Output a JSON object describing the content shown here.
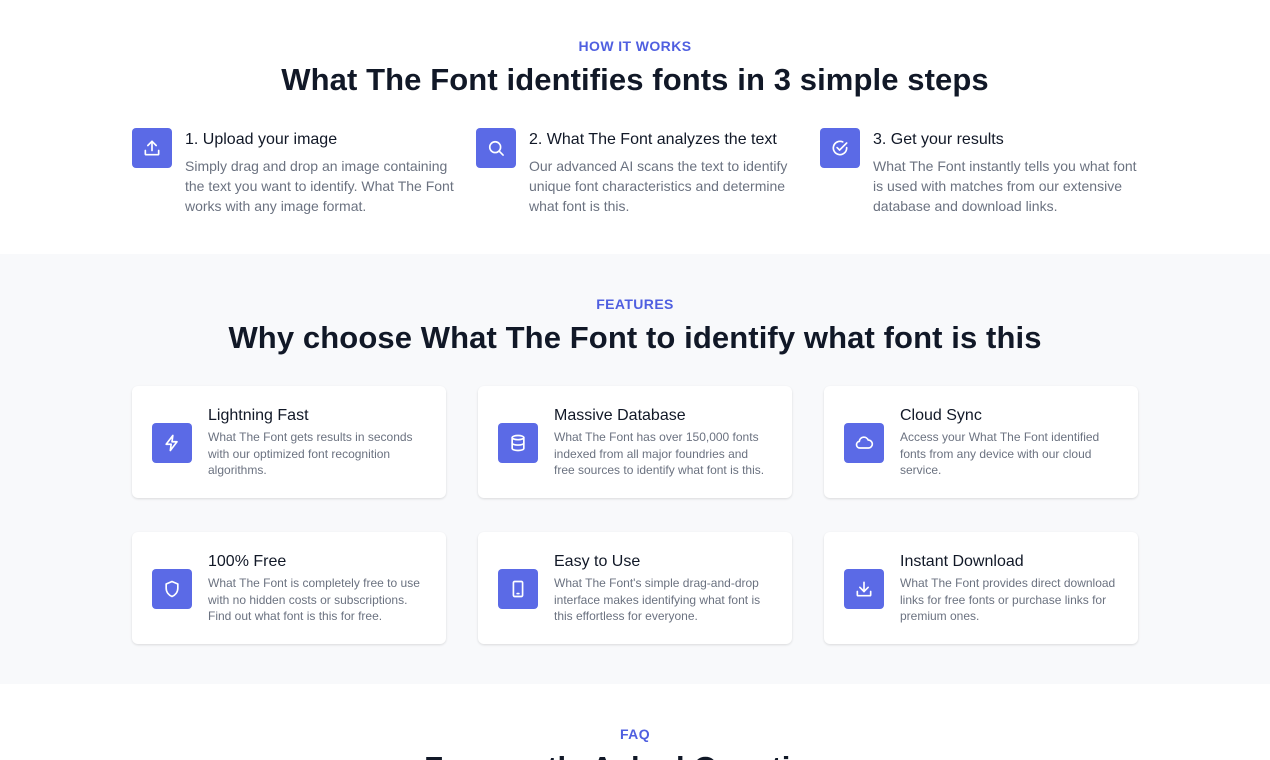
{
  "how_it_works": {
    "eyebrow": "HOW IT WORKS",
    "heading": "What The Font identifies fonts in 3 simple steps",
    "steps": [
      {
        "icon": "upload-icon",
        "title": "1. Upload your image",
        "description": "Simply drag and drop an image containing the text you want to identify. What The Font works with any image format."
      },
      {
        "icon": "search-icon",
        "title": "2. What The Font analyzes the text",
        "description": "Our advanced AI scans the text to identify unique font characteristics and determine what font is this."
      },
      {
        "icon": "check-circle-icon",
        "title": "3. Get your results",
        "description": "What The Font instantly tells you what font is used with matches from our extensive database and download links."
      }
    ]
  },
  "features": {
    "eyebrow": "FEATURES",
    "heading": "Why choose What The Font to identify what font is this",
    "cards": [
      {
        "icon": "lightning-icon",
        "title": "Lightning Fast",
        "description": "What The Font gets results in seconds with our optimized font recognition algorithms."
      },
      {
        "icon": "database-icon",
        "title": "Massive Database",
        "description": "What The Font has over 150,000 fonts indexed from all major foundries and free sources to identify what font is this."
      },
      {
        "icon": "cloud-icon",
        "title": "Cloud Sync",
        "description": "Access your What The Font identified fonts from any device with our cloud service."
      },
      {
        "icon": "shield-icon",
        "title": "100% Free",
        "description": "What The Font is completely free to use with no hidden costs or subscriptions. Find out what font is this for free."
      },
      {
        "icon": "mobile-icon",
        "title": "Easy to Use",
        "description": "What The Font's simple drag-and-drop interface makes identifying what font is this effortless for everyone."
      },
      {
        "icon": "download-icon",
        "title": "Instant Download",
        "description": "What The Font provides direct download links for free fonts or purchase links for premium ones."
      }
    ]
  },
  "faq": {
    "eyebrow": "FAQ",
    "heading": "Frequently Asked Questions"
  },
  "colors": {
    "accent": "#4f5fe0",
    "icon_bg": "#5b6ae6",
    "heading": "#111827",
    "muted_text": "#6b7280",
    "features_bg": "#f8f9fb"
  }
}
